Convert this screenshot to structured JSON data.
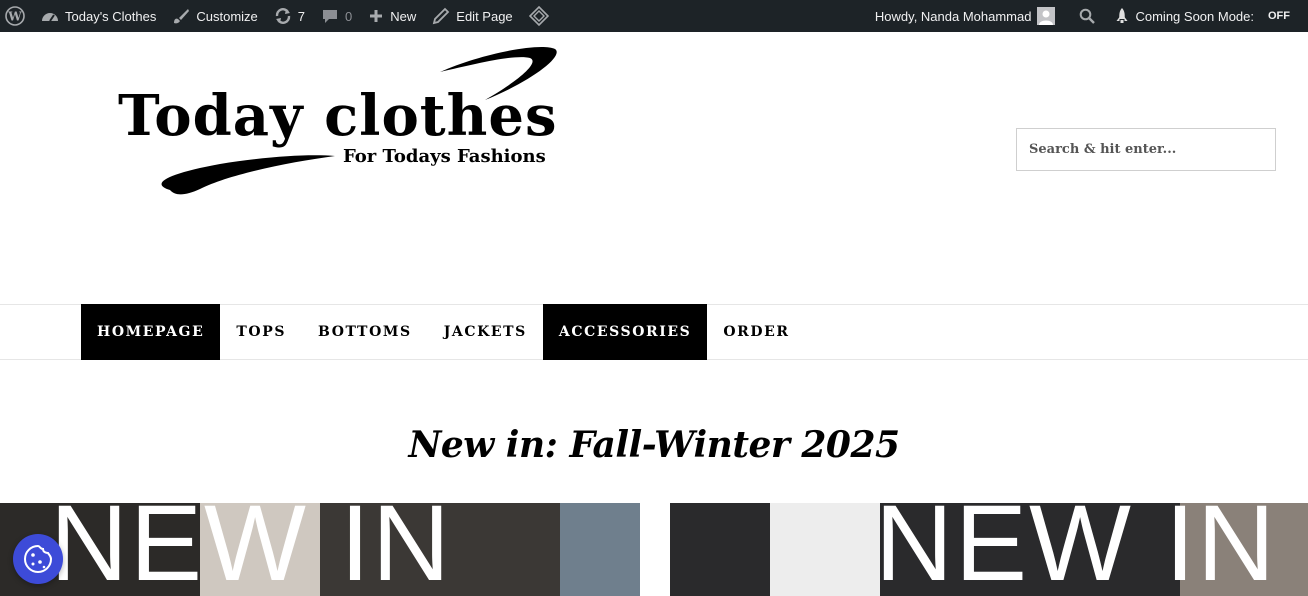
{
  "adminbar": {
    "site_name": "Today's Clothes",
    "customize": "Customize",
    "updates_count": "7",
    "comments_count": "0",
    "new_label": "New",
    "edit_page": "Edit Page",
    "howdy": "Howdy, Nanda Mohammad",
    "coming_soon": "Coming Soon Mode:",
    "coming_soon_state": "OFF"
  },
  "header": {
    "logo_title": "Today clothes",
    "logo_tagline": "For Todays Fashions",
    "search_placeholder": "Search & hit enter..."
  },
  "nav": {
    "items": [
      {
        "label": "HOMEPAGE"
      },
      {
        "label": "TOPS"
      },
      {
        "label": "BOTTOMS"
      },
      {
        "label": "JACKETS"
      },
      {
        "label": "ACCESSORIES"
      },
      {
        "label": "ORDER"
      }
    ]
  },
  "main": {
    "headline": "New in: Fall-Winter 2025",
    "banner_text_left": "NEW IN",
    "banner_text_right": "NEW IN"
  },
  "colors": {
    "adminbar_bg": "#1d2327",
    "cookie_button": "#3d4bd8",
    "nav_active": "#000000"
  }
}
